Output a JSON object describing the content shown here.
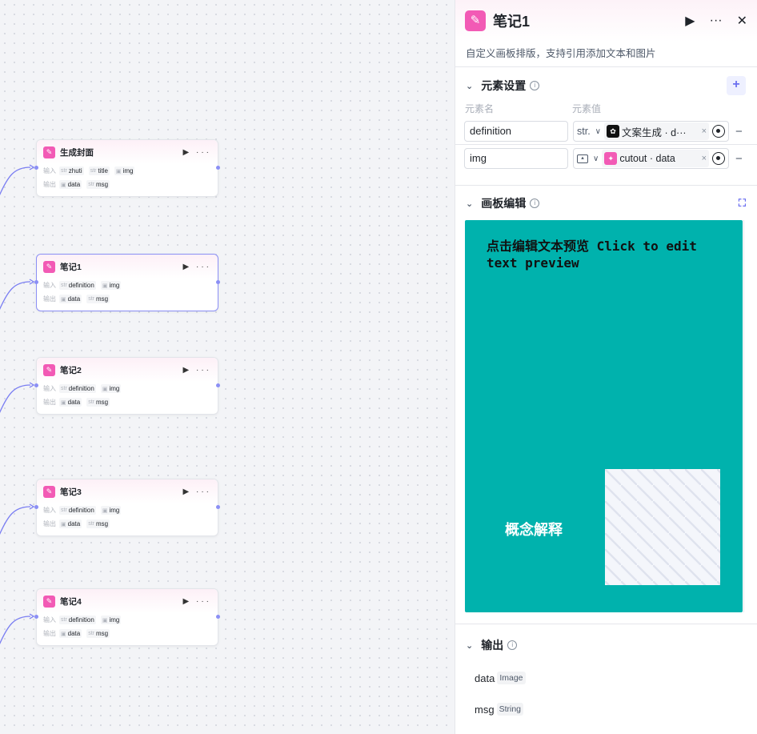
{
  "canvas": {
    "nodes": [
      {
        "title": "生成封面",
        "in_label": "输入",
        "out_label": "输出",
        "inputs": [
          {
            "type": "str",
            "name": "zhuti"
          },
          {
            "type": "str",
            "name": "title"
          },
          {
            "type": "img",
            "name": "img"
          }
        ],
        "outputs": [
          {
            "type": "img",
            "name": "data"
          },
          {
            "type": "str",
            "name": "msg"
          }
        ]
      },
      {
        "title": "笔记1",
        "in_label": "输入",
        "out_label": "输出",
        "inputs": [
          {
            "type": "str",
            "name": "definition"
          },
          {
            "type": "img",
            "name": "img"
          }
        ],
        "outputs": [
          {
            "type": "img",
            "name": "data"
          },
          {
            "type": "str",
            "name": "msg"
          }
        ]
      },
      {
        "title": "笔记2",
        "in_label": "输入",
        "out_label": "输出",
        "inputs": [
          {
            "type": "str",
            "name": "definition"
          },
          {
            "type": "img",
            "name": "img"
          }
        ],
        "outputs": [
          {
            "type": "img",
            "name": "data"
          },
          {
            "type": "str",
            "name": "msg"
          }
        ]
      },
      {
        "title": "笔记3",
        "in_label": "输入",
        "out_label": "输出",
        "inputs": [
          {
            "type": "str",
            "name": "definition"
          },
          {
            "type": "img",
            "name": "img"
          }
        ],
        "outputs": [
          {
            "type": "img",
            "name": "data"
          },
          {
            "type": "str",
            "name": "msg"
          }
        ]
      },
      {
        "title": "笔记4",
        "in_label": "输入",
        "out_label": "输出",
        "inputs": [
          {
            "type": "str",
            "name": "definition"
          },
          {
            "type": "img",
            "name": "img"
          }
        ],
        "outputs": [
          {
            "type": "img",
            "name": "data"
          },
          {
            "type": "str",
            "name": "msg"
          }
        ]
      }
    ]
  },
  "panel": {
    "title": "笔记1",
    "description": "自定义画板排版，支持引用添加文本和图片",
    "elements_section": {
      "title": "元素设置",
      "col_name": "元素名",
      "col_value": "元素值",
      "rows": [
        {
          "name": "definition",
          "type": "str.",
          "ref_text": "文案生成 · d···"
        },
        {
          "name": "img",
          "type": "",
          "ref_text": "cutout · data"
        }
      ]
    },
    "board_section": {
      "title": "画板编辑",
      "text_preview": "点击编辑文本预览 Click to edit text preview",
      "text2": "概念解释"
    },
    "output_section": {
      "title": "输出",
      "items": [
        {
          "name": "data",
          "type": "Image"
        },
        {
          "name": "msg",
          "type": "String"
        }
      ]
    }
  },
  "colors": {
    "accent": "#8b8ff5",
    "node_icon": "#f25ab5",
    "board_bg": "#00b2ad"
  }
}
